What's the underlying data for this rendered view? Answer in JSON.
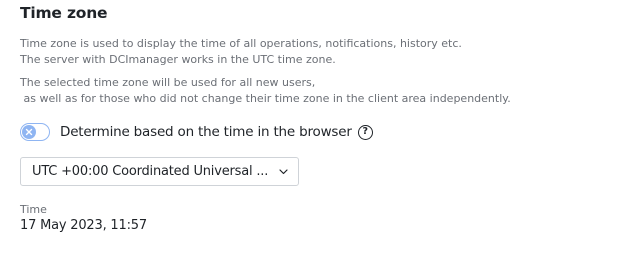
{
  "section": {
    "title": "Time zone",
    "description_1": "Time zone is used to display the time of all operations, notifications, history etc.\nThe server with DCImanager works in the UTC time zone.",
    "description_2": "The selected time zone will be used for all new users,\n as well as for those who did not change their time zone in the client area independently."
  },
  "browser_toggle": {
    "label": "Determine based on the time in the browser",
    "enabled": false,
    "help_symbol": "?"
  },
  "timezone_select": {
    "value": "UTC +00:00  Coordinated Universal ..."
  },
  "time": {
    "label": "Time",
    "value": "17 May 2023, 11:57"
  },
  "colors": {
    "toggle_accent": "#8fb5f2",
    "text_primary": "#1f2328",
    "text_secondary": "#6b6f76"
  },
  "icons": {
    "toggle_off": "x-icon",
    "help": "question-circle-icon",
    "select_arrow": "chevron-down-icon"
  }
}
